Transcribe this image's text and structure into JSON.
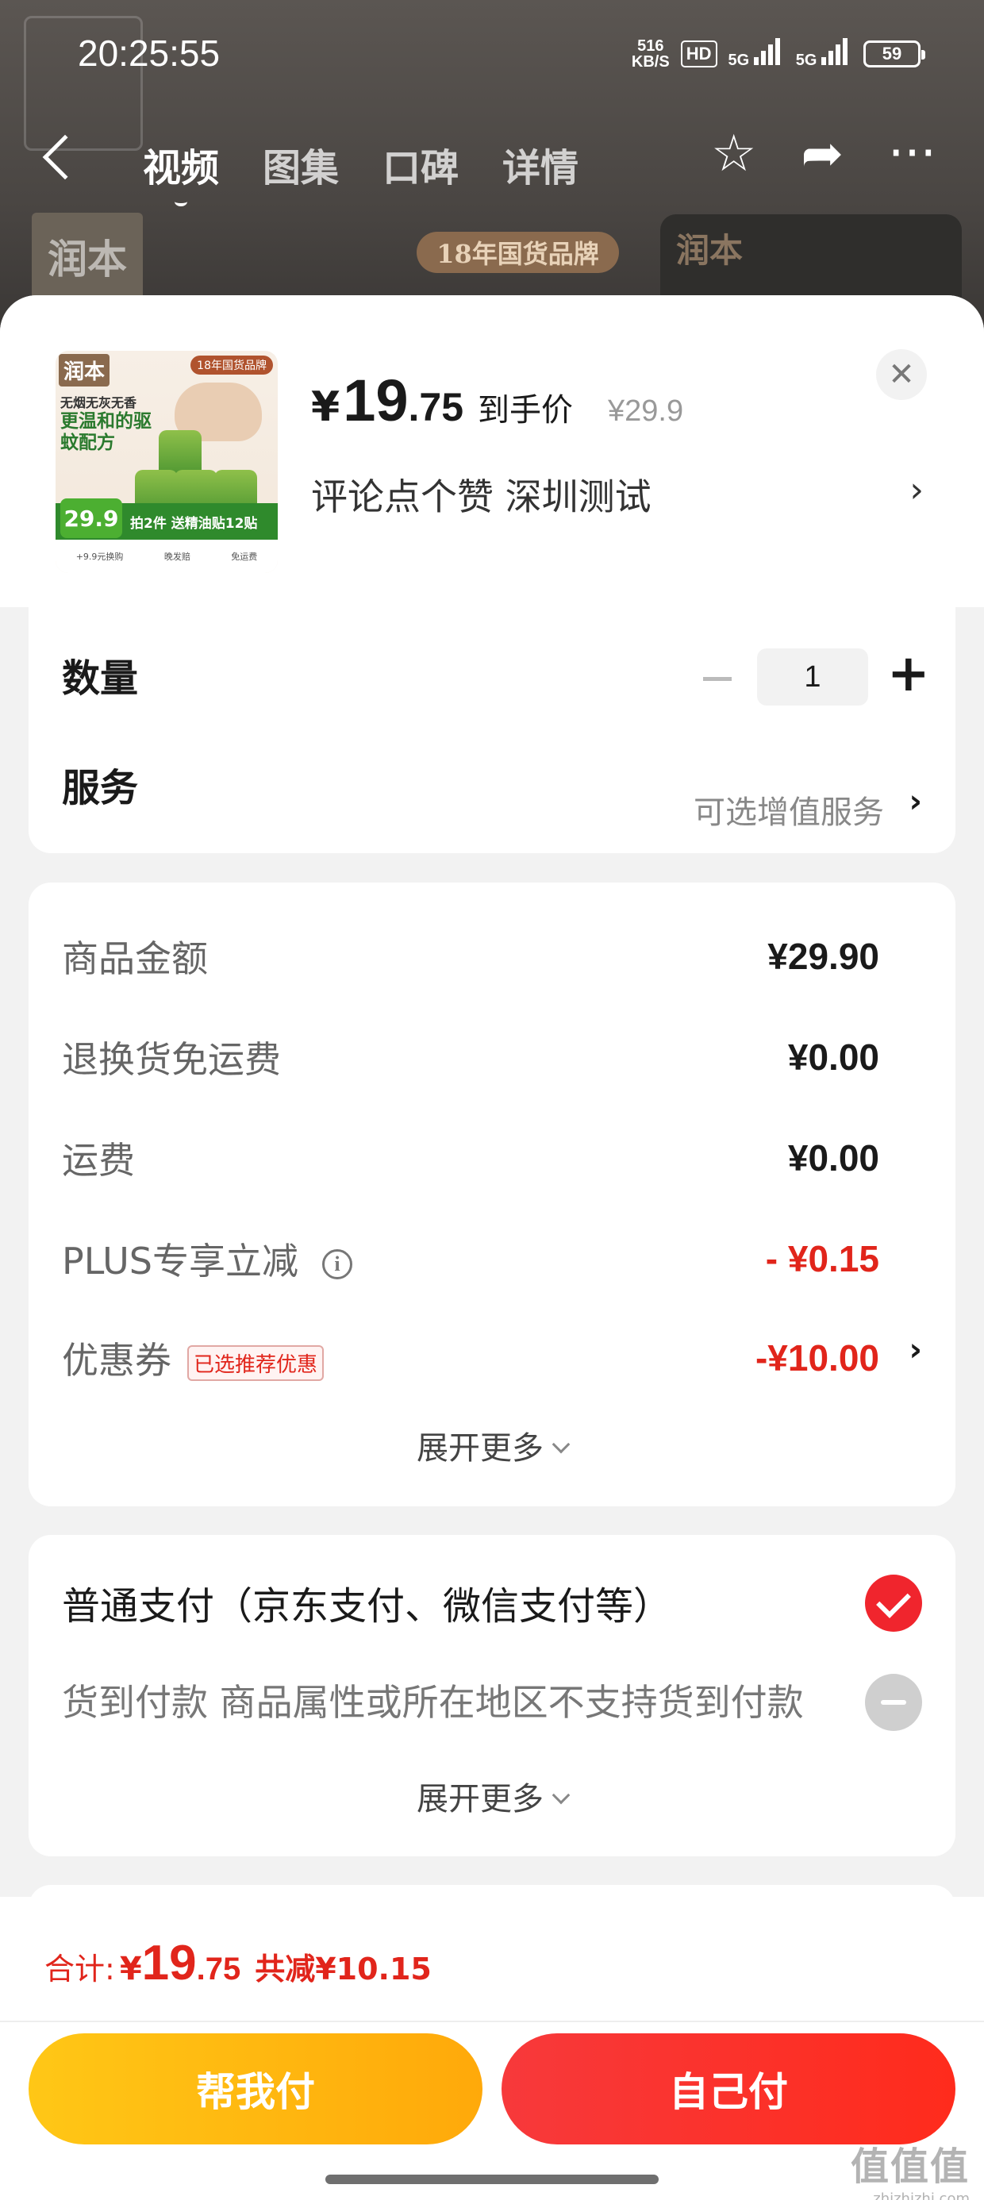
{
  "status_bar": {
    "time": "20:25:55",
    "net_speed": "516",
    "net_unit": "KB/S",
    "hd": "HD",
    "sig1": "5G",
    "sig2": "5G",
    "battery": "59"
  },
  "top_nav": {
    "tabs": [
      "视频",
      "图集",
      "口碑",
      "详情"
    ],
    "active_tab": "视频"
  },
  "background": {
    "brand_logo": "润本",
    "banner": "18年国货品牌"
  },
  "product": {
    "thumb": {
      "logo": "润本",
      "badge": "18年国货品牌",
      "line1": "无烟无灰无香",
      "line2": "更温和的驱蚊配方",
      "price": "29.9",
      "promo": "拍2件 送精油贴12贴",
      "foot": [
        "+9.9元换购",
        "晚发赔",
        "免运费"
      ]
    },
    "currency": "¥",
    "price_int": "19",
    "price_dec": ".75",
    "price_label": "到手价",
    "orig_price": "¥29.9",
    "spec": "评论点个赞  深圳测试"
  },
  "quantity": {
    "label": "数量",
    "value": "1"
  },
  "service": {
    "label": "服务",
    "value": "可选增值服务"
  },
  "amounts": {
    "rows": [
      {
        "label": "商品金额",
        "value": "¥29.90"
      },
      {
        "label": "退换货免运费",
        "value": "¥0.00"
      },
      {
        "label": "运费",
        "value": "¥0.00"
      },
      {
        "label": "PLUS专享立减",
        "value": "- ¥0.15"
      },
      {
        "label": "优惠券",
        "value": "-¥10.00"
      }
    ],
    "coupon_tag": "已选推荐优惠",
    "expand": "展开更多"
  },
  "payment": {
    "normal": "普通支付（京东支付、微信支付等）",
    "cod": "货到付款 商品属性或所在地区不支持货到付款",
    "expand": "展开更多"
  },
  "bottom": {
    "total_label": "合计:",
    "total_currency": "¥",
    "total_int": "19",
    "total_dec": ".75",
    "reduced": "共减¥10.15",
    "help_pay": "帮我付",
    "self_pay": "自己付"
  },
  "watermark": {
    "logo": "值值值",
    "url": "zhizhizhi.com"
  },
  "colors": {
    "accent_red": "#e1251b",
    "check_red": "#f0252d",
    "help_yellow": "#ffb20f",
    "self_red": "#f7393b"
  }
}
